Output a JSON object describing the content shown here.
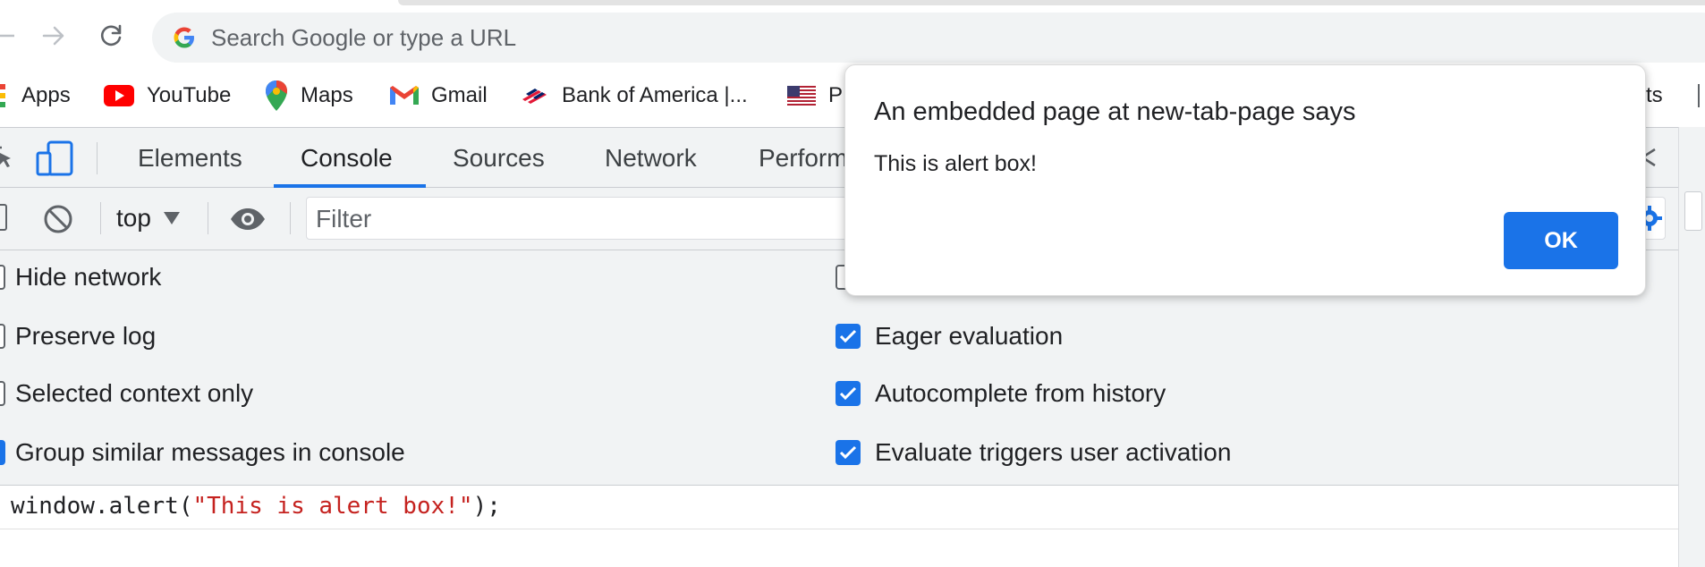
{
  "browser": {
    "omnibox_placeholder": "Search Google or type a URL",
    "bookmarks": [
      {
        "label": "Apps",
        "icon": "apps-grid-icon"
      },
      {
        "label": "YouTube",
        "icon": "youtube-icon"
      },
      {
        "label": "Maps",
        "icon": "maps-pin-icon"
      },
      {
        "label": "Gmail",
        "icon": "gmail-icon"
      },
      {
        "label": "Bank of America |...",
        "icon": "bank-of-america-icon"
      },
      {
        "label": "P",
        "icon": "us-flag-icon"
      }
    ],
    "bookmark_partial_right": "cts"
  },
  "devtools": {
    "tabs": [
      "Elements",
      "Console",
      "Sources",
      "Network",
      "Perform"
    ],
    "active_tab": "Console",
    "context": "top",
    "filter_placeholder": "Filter",
    "settings_left": [
      {
        "label": "Hide network",
        "checked": false
      },
      {
        "label": "Preserve log",
        "checked": false
      },
      {
        "label": "Selected context only",
        "checked": false
      },
      {
        "label": "Group similar messages in console",
        "checked": true
      }
    ],
    "settings_right": [
      {
        "label": "",
        "checked": false
      },
      {
        "label": "Eager evaluation",
        "checked": true
      },
      {
        "label": "Autocomplete from history",
        "checked": true
      },
      {
        "label": "Evaluate triggers user activation",
        "checked": true
      }
    ],
    "console_code": {
      "prefix": "window.alert(",
      "string": "\"This is alert box!\"",
      "suffix": ");"
    }
  },
  "alert": {
    "title": "An embedded page at new-tab-page says",
    "message": "This is alert box!",
    "ok_label": "OK"
  },
  "colors": {
    "accent": "#1a73e8",
    "devtools_bg": "#f1f3f4",
    "string_red": "#c5221f"
  }
}
